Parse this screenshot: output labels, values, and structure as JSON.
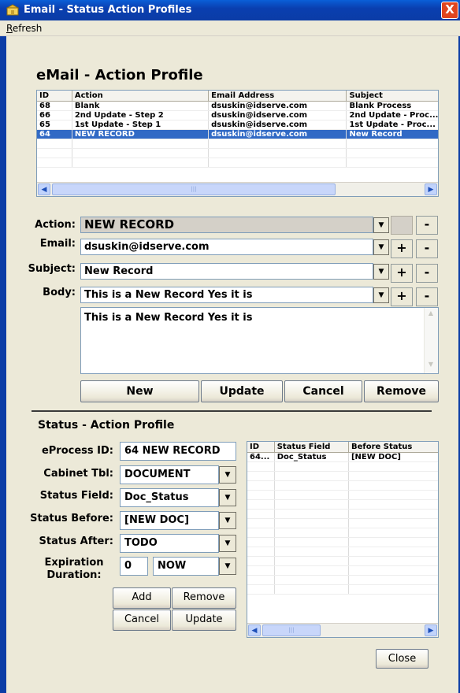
{
  "window": {
    "title": "Email - Status Action Profiles",
    "close": "X"
  },
  "menu": {
    "refresh": "Refresh"
  },
  "email_profile": {
    "heading": "eMail - Action Profile",
    "columns": [
      "ID",
      "Action",
      "Email Address",
      "Subject"
    ],
    "rows": [
      {
        "id": "68",
        "action": "Blank",
        "email": "dsuskin@idserve.com",
        "subject": "Blank Process"
      },
      {
        "id": "66",
        "action": "2nd Update - Step 2",
        "email": "dsuskin@idserve.com",
        "subject": "2nd Update - Proc..."
      },
      {
        "id": "65",
        "action": "1st Update - Step 1",
        "email": "dsuskin@idserve.com",
        "subject": "1st Update - Proc..."
      },
      {
        "id": "64",
        "action": "NEW RECORD",
        "email": "dsuskin@idserve.com",
        "subject": "New Record"
      }
    ],
    "selected_row": 3,
    "form": {
      "action_label": "Action:",
      "action_value": "NEW RECORD",
      "email_label": "Email:",
      "email_value": "dsuskin@idserve.com",
      "subject_label": "Subject:",
      "subject_value": "New Record",
      "body_label": "Body:",
      "body_value": "This is a New Record Yes it is",
      "body_text": "This is a New Record Yes it is"
    },
    "buttons": {
      "new": "New",
      "update": "Update",
      "cancel": "Cancel",
      "remove": "Remove",
      "plus": "+",
      "minus": "-"
    }
  },
  "status_profile": {
    "heading": "Status - Action Profile",
    "eprocess_label": "eProcess ID:",
    "eprocess_value": "64 NEW RECORD",
    "cabinet_label": "Cabinet Tbl:",
    "cabinet_value": "DOCUMENT",
    "status_field_label": "Status Field:",
    "status_field_value": "Doc_Status",
    "status_before_label": "Status Before:",
    "status_before_value": "[NEW DOC]",
    "status_after_label": "Status After:",
    "status_after_value": "TODO",
    "expiration_label_1": "Expiration",
    "expiration_label_2": "Duration:",
    "expiration_number": "0",
    "expiration_unit": "NOW",
    "buttons": {
      "add": "Add",
      "remove": "Remove",
      "cancel": "Cancel",
      "update": "Update"
    },
    "columns": [
      "ID",
      "Status Field",
      "Before Status"
    ],
    "rows": [
      {
        "id": "64...",
        "field": "Doc_Status",
        "before": "[NEW DOC]"
      }
    ]
  },
  "close_button": "Close",
  "icons": {
    "dropdown": "chevron-down-icon",
    "scroll_left": "arrow-left-icon",
    "scroll_right": "arrow-right-icon",
    "app": "envelope-icon"
  },
  "colors": {
    "titlebar": "#0b3ca6",
    "selection": "#316ac5",
    "close": "#e0451f",
    "background": "#ece9d8"
  }
}
